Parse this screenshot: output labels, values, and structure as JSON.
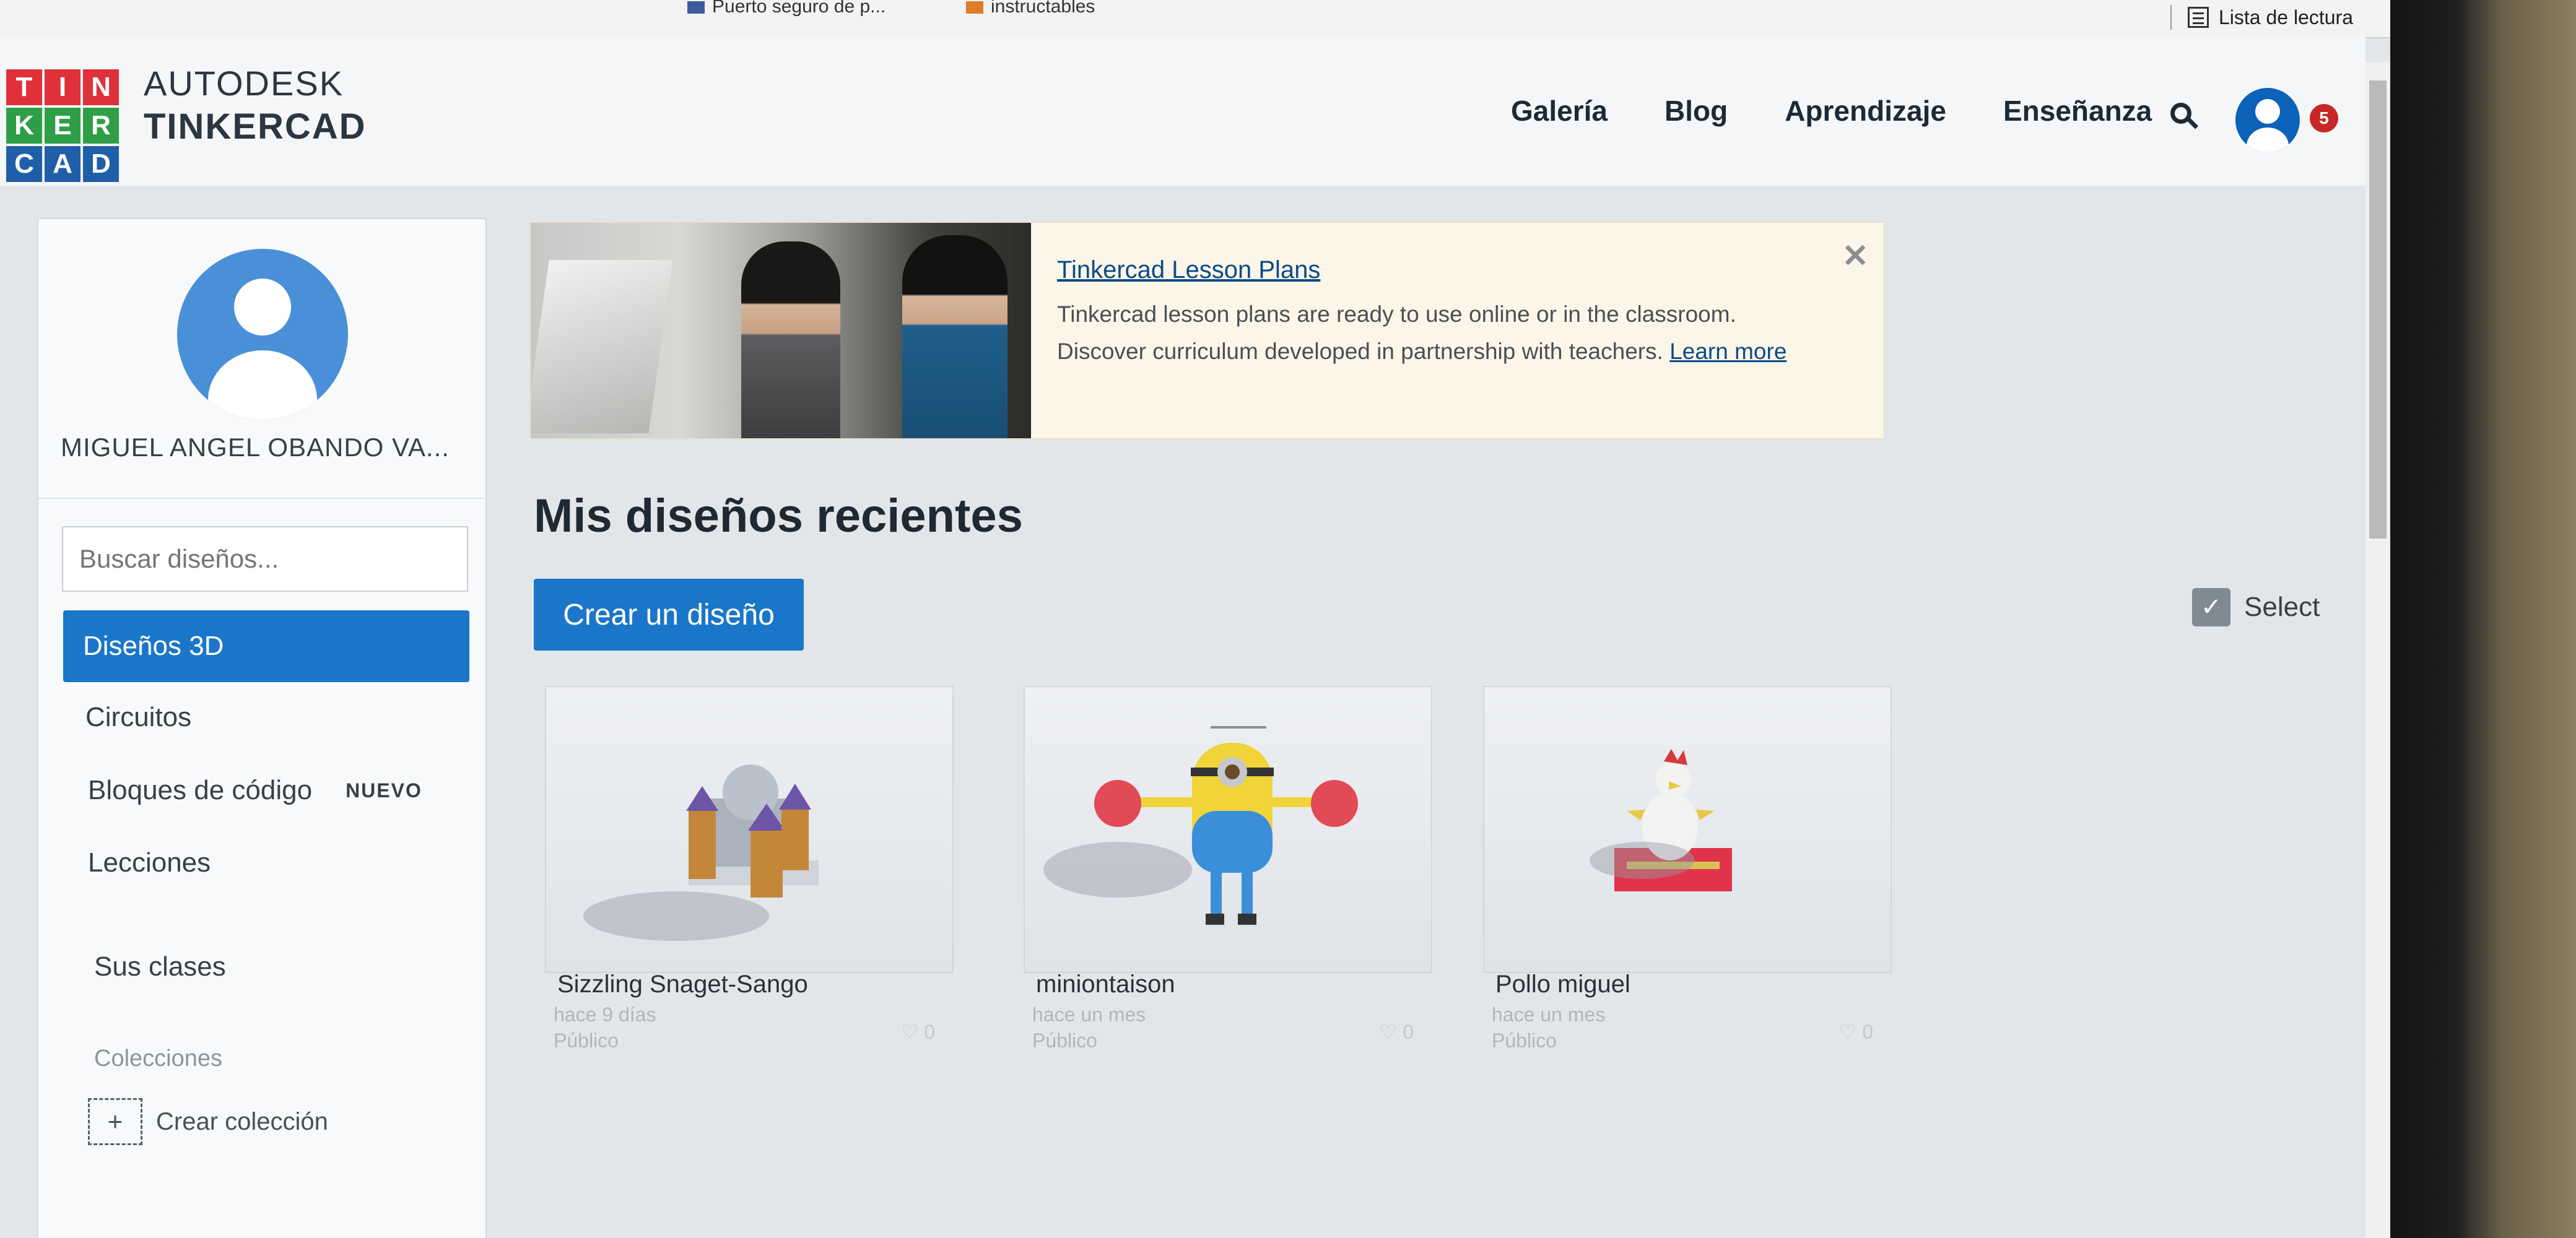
{
  "browser": {
    "bookmarks": [
      "Puerto seguro de p...",
      "instructables"
    ],
    "reading_list": "Lista de lectura"
  },
  "header": {
    "logo_tiles": [
      "T",
      "I",
      "N",
      "K",
      "E",
      "R",
      "C",
      "A",
      "D"
    ],
    "brand_line1": "AUTODESK",
    "brand_line2": "TINKERCAD",
    "nav": [
      "Galería",
      "Blog",
      "Aprendizaje",
      "Enseñanza"
    ],
    "notification_count": "5",
    "colors": {
      "red": "#e0303a",
      "green": "#2e9f46",
      "blue": "#1f5fa8",
      "accent": "#1a76c9"
    }
  },
  "sidebar": {
    "user_name": "MIGUEL ANGEL OBANDO VA...",
    "search_placeholder": "Buscar diseños...",
    "items": [
      {
        "label": "Diseños 3D"
      },
      {
        "label": "Circuitos"
      },
      {
        "label": "Bloques de código",
        "badge": "NUEVO"
      },
      {
        "label": "Lecciones"
      },
      {
        "label": "Sus clases"
      }
    ],
    "collections_label": "Colecciones",
    "create_collection": "Crear colección"
  },
  "banner": {
    "title": "Tinkercad Lesson Plans",
    "text": "Tinkercad lesson plans are ready to use online or in the classroom. Discover curriculum developed in partnership with teachers.",
    "link": "Learn more",
    "close": "✕"
  },
  "main": {
    "title": "Mis diseños recientes",
    "create_button": "Crear un diseño",
    "select_label": "Select",
    "designs": [
      {
        "name": "Sizzling Snaget-Sango",
        "time": "hace 9 días",
        "visibility": "Público",
        "likes": "♡ 0"
      },
      {
        "name": "miniontaison",
        "time": "hace un mes",
        "visibility": "Público",
        "likes": "♡ 0"
      },
      {
        "name": "Pollo miguel",
        "time": "hace un mes",
        "visibility": "Público",
        "likes": "♡ 0"
      }
    ]
  }
}
